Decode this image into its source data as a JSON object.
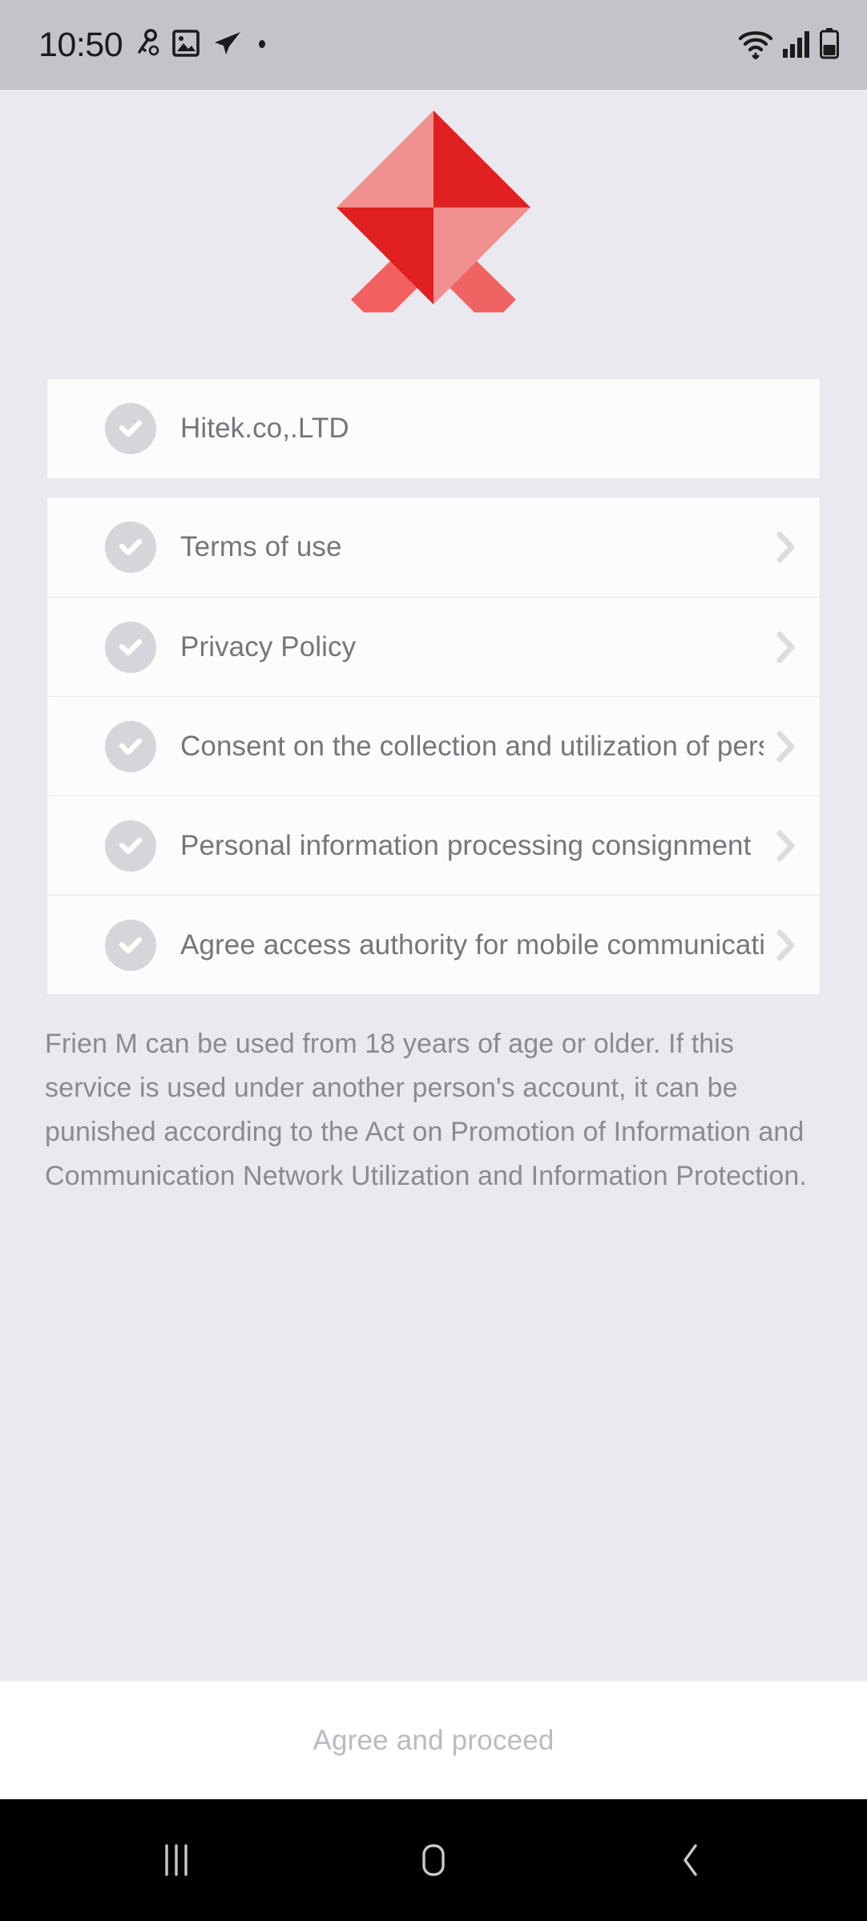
{
  "status_bar": {
    "time": "10:50",
    "left_icons": [
      "key-icon",
      "image-icon",
      "telegram-paper-plane-icon",
      "dot-icon"
    ],
    "right_icons": [
      "wifi-icon",
      "cellular-signal-icon",
      "battery-icon"
    ],
    "background_color": "#c3c3ca"
  },
  "brand": {
    "logo_name": "frien-m-logo",
    "color_dark": "#e02020",
    "color_mid": "#f2615f",
    "color_light": "#f0908e"
  },
  "company_card": {
    "label": "Hitek.co,.LTD",
    "icon": "check-circle-icon"
  },
  "agreements": {
    "items": [
      {
        "label": "Terms of use",
        "icon": "check-circle-icon",
        "chevron": "chevron-right-icon"
      },
      {
        "label": "Privacy Policy",
        "icon": "check-circle-icon",
        "chevron": "chevron-right-icon"
      },
      {
        "label": "Consent on the collection and utilization of pers..",
        "icon": "check-circle-icon",
        "chevron": "chevron-right-icon"
      },
      {
        "label": "Personal information processing consignment",
        "icon": "check-circle-icon",
        "chevron": "chevron-right-icon"
      },
      {
        "label": "Agree access authority for mobile communicati...",
        "icon": "check-circle-icon",
        "chevron": "chevron-right-icon"
      }
    ]
  },
  "notice": {
    "text": "Frien M can be used from 18 years of age or older. If this service is used under another person's account, it can be punished according to the Act on Promotion of Information and Communication Network Utilization and Information Protection."
  },
  "bottom": {
    "proceed_label": "Agree and proceed"
  },
  "nav_bar": {
    "recents_icon": "recents-icon",
    "home_icon": "home-icon",
    "back_icon": "back-chevron-icon"
  },
  "colors": {
    "page_background": "#eae9ef",
    "card_background": "#fcfcfd",
    "text_muted": "#76757c",
    "notice_text": "#8b8a91",
    "disabled_button_text": "#bbbac2",
    "check_circle": "#d6d5da",
    "chevron": "#dcdbe1"
  }
}
